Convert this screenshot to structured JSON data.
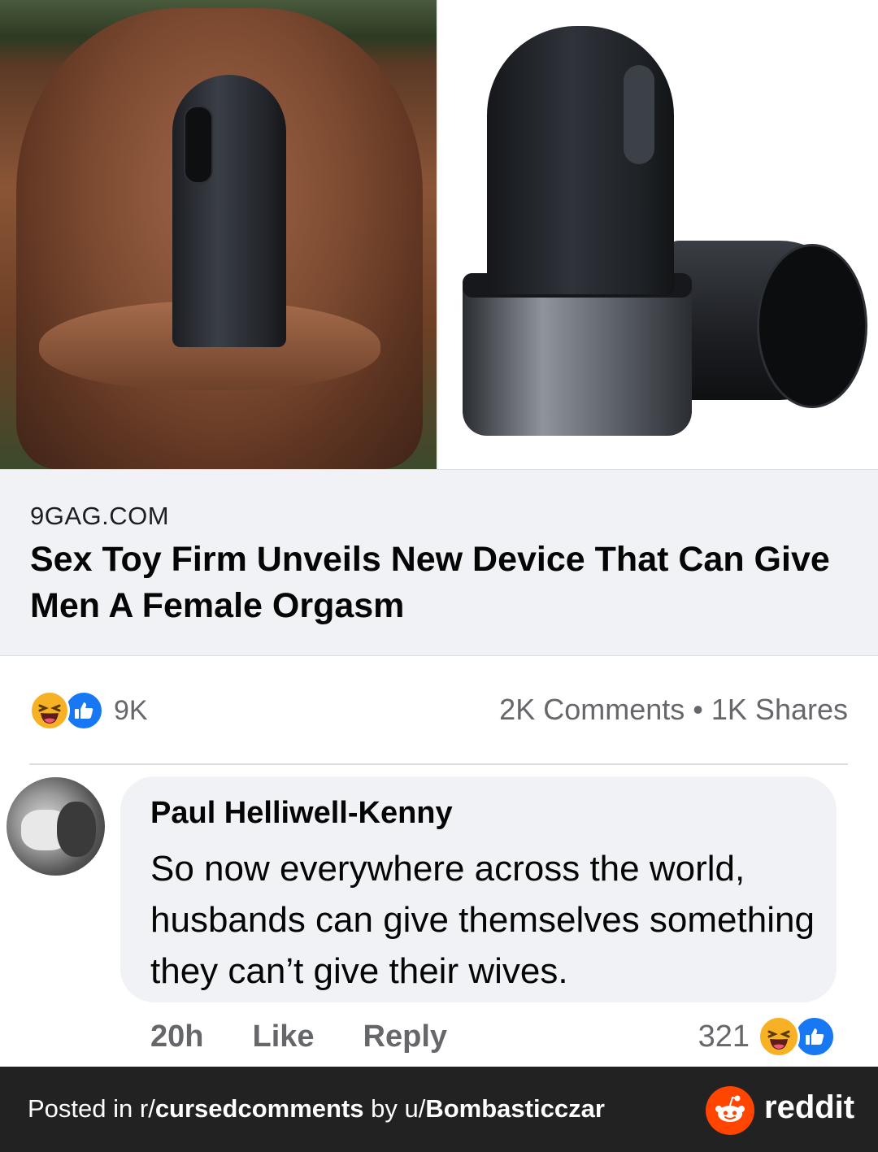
{
  "link_preview": {
    "domain": "9GAG.COM",
    "title": "Sex Toy Firm Unveils New Device That Can Give Men A Female Orgasm"
  },
  "post_stats": {
    "reaction_count": "9K",
    "comments": "2K Comments",
    "separator": "•",
    "shares": "1K Shares",
    "reaction_icons": [
      "haha-icon",
      "like-icon"
    ]
  },
  "comment": {
    "author": "Paul Helliwell-Kenny",
    "text": "So now everywhere across the world, husbands can give themselves something they can’t give their wives.",
    "time": "20h",
    "like_label": "Like",
    "reply_label": "Reply",
    "reaction_count": "321"
  },
  "footer": {
    "prefix": "Posted in r/",
    "subreddit": "cursedcomments",
    "by": " by u/",
    "username": "Bombasticczar",
    "brand": "reddit"
  },
  "colors": {
    "facebook_blue": "#1877f2",
    "haha_yellow": "#f7b125",
    "reddit_orange": "#ff4500",
    "footer_bg": "#222222"
  }
}
